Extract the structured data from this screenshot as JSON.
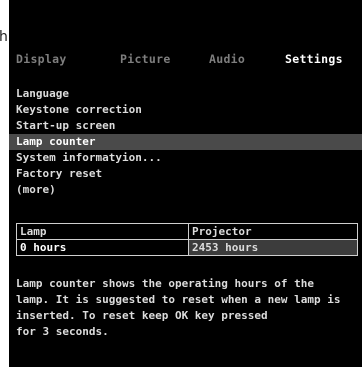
{
  "window_edge_text": "h",
  "tabs": [
    {
      "label": "Display",
      "active": false
    },
    {
      "label": "Picture",
      "active": false
    },
    {
      "label": "Audio",
      "active": false
    },
    {
      "label": "Settings",
      "active": true
    }
  ],
  "menu": {
    "items": [
      {
        "label": "Language"
      },
      {
        "label": "Keystone correction"
      },
      {
        "label": "Start-up screen"
      },
      {
        "label": "Lamp counter",
        "selected": true
      },
      {
        "label": "System informatyion..."
      },
      {
        "label": "Factory reset"
      },
      {
        "label": "(more)"
      }
    ]
  },
  "info_table": {
    "headers": [
      "Lamp",
      "Projector"
    ],
    "values": [
      "0 hours",
      "2453 hours"
    ]
  },
  "description": {
    "lines": [
      "Lamp counter shows the operating hours of the",
      "lamp. It is suggested to reset when a new lamp is",
      "inserted. To reset keep OK key pressed",
      "for 3 seconds."
    ]
  },
  "colors": {
    "background": "#000000",
    "selected_row": "#4a4a4a",
    "inactive_tab": "#7e7e7e",
    "text": "#dcdcdc"
  }
}
